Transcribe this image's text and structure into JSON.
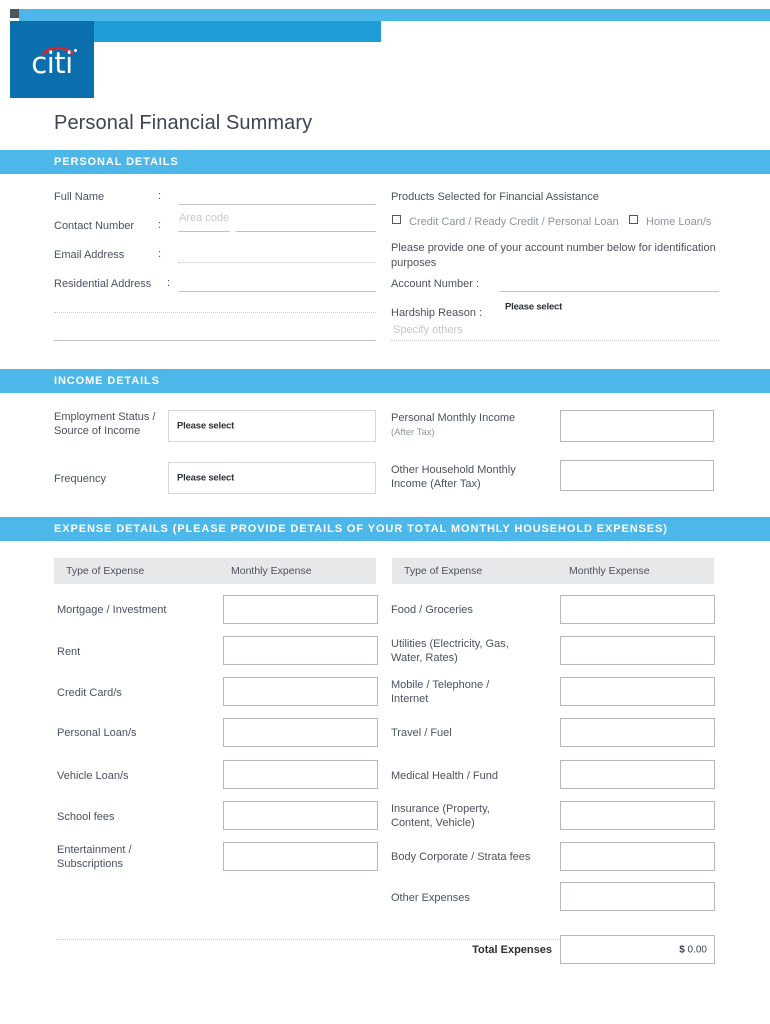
{
  "brand": {
    "logo_text": "citi",
    "accent_light": "#4cb7e8",
    "accent_mid": "#1e9dd8",
    "accent_dark": "#0b6ead",
    "arc_color": "#d8272c"
  },
  "page_title": "Personal Financial Summary",
  "sections": {
    "personal": "PERSONAL DETAILS",
    "income": "INCOME DETAILS",
    "expense": "EXPENSE DETAILS (PLEASE PROVIDE DETAILS OF YOUR TOTAL MONTHLY HOUSEHOLD EXPENSES)"
  },
  "personal_details": {
    "left_fields": [
      {
        "label": "Full Name",
        "colon": ":",
        "value": ""
      },
      {
        "label": "Contact Number",
        "colon": ":",
        "value": ""
      },
      {
        "label": "Email Address",
        "colon": ":",
        "value": ""
      },
      {
        "label": "Residential Address",
        "colon": ":",
        "value": ""
      }
    ],
    "area_code_placeholder": "Area code",
    "products_heading": "Products Selected for Financial Assistance",
    "products": [
      {
        "label": "Credit Card / Ready Credit / Personal Loan",
        "checked": false
      },
      {
        "label": "Home Loan/s",
        "checked": false
      }
    ],
    "account_note": "Please provide one of your account number below for identification purposes",
    "account_number_label": "Account Number :",
    "account_number_value": "",
    "hardship_label": "Hardship Reason :",
    "hardship_value": "Please select",
    "specify_others_placeholder": "Specify others"
  },
  "income_details": {
    "rows": [
      {
        "left_label_line1": "Employment Status /",
        "left_label_line2": "Source of Income",
        "select_value": "Please select",
        "right_label": "Personal Monthly Income",
        "right_sub": "(After Tax)",
        "right_value": ""
      },
      {
        "left_label_line1": "Frequency",
        "left_label_line2": "",
        "select_value": "Please select",
        "right_label": "Other Household Monthly",
        "right_sub": "Income (After Tax)",
        "right_value": ""
      }
    ]
  },
  "expense_details": {
    "columns": {
      "type_header": "Type of Expense",
      "amount_header": "Monthly Expense"
    },
    "left_rows": [
      {
        "label_line1": "Mortgage / Investment",
        "label_line2": "",
        "value": ""
      },
      {
        "label_line1": "Rent",
        "label_line2": "",
        "value": ""
      },
      {
        "label_line1": "Credit Card/s",
        "label_line2": "",
        "value": ""
      },
      {
        "label_line1": "Personal Loan/s",
        "label_line2": "",
        "value": ""
      },
      {
        "label_line1": "Vehicle Loan/s",
        "label_line2": "",
        "value": ""
      },
      {
        "label_line1": "School fees",
        "label_line2": "",
        "value": ""
      },
      {
        "label_line1": "Entertainment /",
        "label_line2": "Subscriptions",
        "value": ""
      }
    ],
    "right_rows": [
      {
        "label_line1": "Food / Groceries",
        "label_line2": "",
        "value": ""
      },
      {
        "label_line1": "Utilities (Electricity, Gas,",
        "label_line2": "Water, Rates)",
        "value": ""
      },
      {
        "label_line1": "Mobile / Telephone /",
        "label_line2": "Internet",
        "value": ""
      },
      {
        "label_line1": "Travel / Fuel",
        "label_line2": "",
        "value": ""
      },
      {
        "label_line1": "Medical Health / Fund",
        "label_line2": "",
        "value": ""
      },
      {
        "label_line1": "Insurance (Property,",
        "label_line2": "Content, Vehicle)",
        "value": ""
      },
      {
        "label_line1": "Body Corporate / Strata fees",
        "label_line2": "",
        "value": ""
      },
      {
        "label_line1": "Other Expenses",
        "label_line2": "",
        "value": ""
      }
    ],
    "total_label": "Total Expenses",
    "total_currency": "$",
    "total_value": "0.00"
  }
}
